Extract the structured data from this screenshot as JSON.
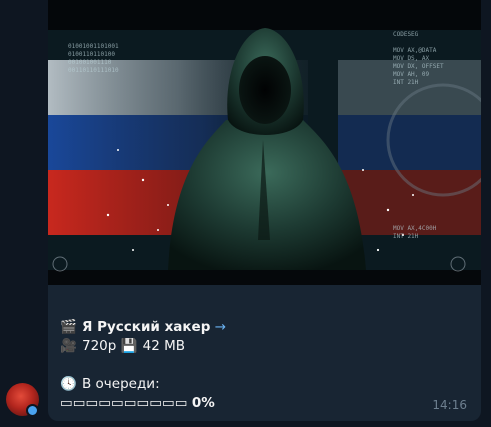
{
  "message": {
    "title": "Я Русский хакер",
    "title_arrow": "→",
    "quality": "720p",
    "size": "42 MB",
    "status_label": "В очереди:",
    "progress_bar": "▭▭▭▭▭▭▭▭▭▭",
    "progress_percent": "0%",
    "time": "14:16"
  },
  "icons": {
    "title": "clapperboard-icon",
    "quality": "movie-camera-icon",
    "size": "floppy-disk-icon",
    "status": "clock-icon"
  },
  "colors": {
    "background": "#0e1621",
    "bubble": "#182533",
    "link_accent": "#6ab2f2",
    "timestamp": "#6d7f8f"
  }
}
